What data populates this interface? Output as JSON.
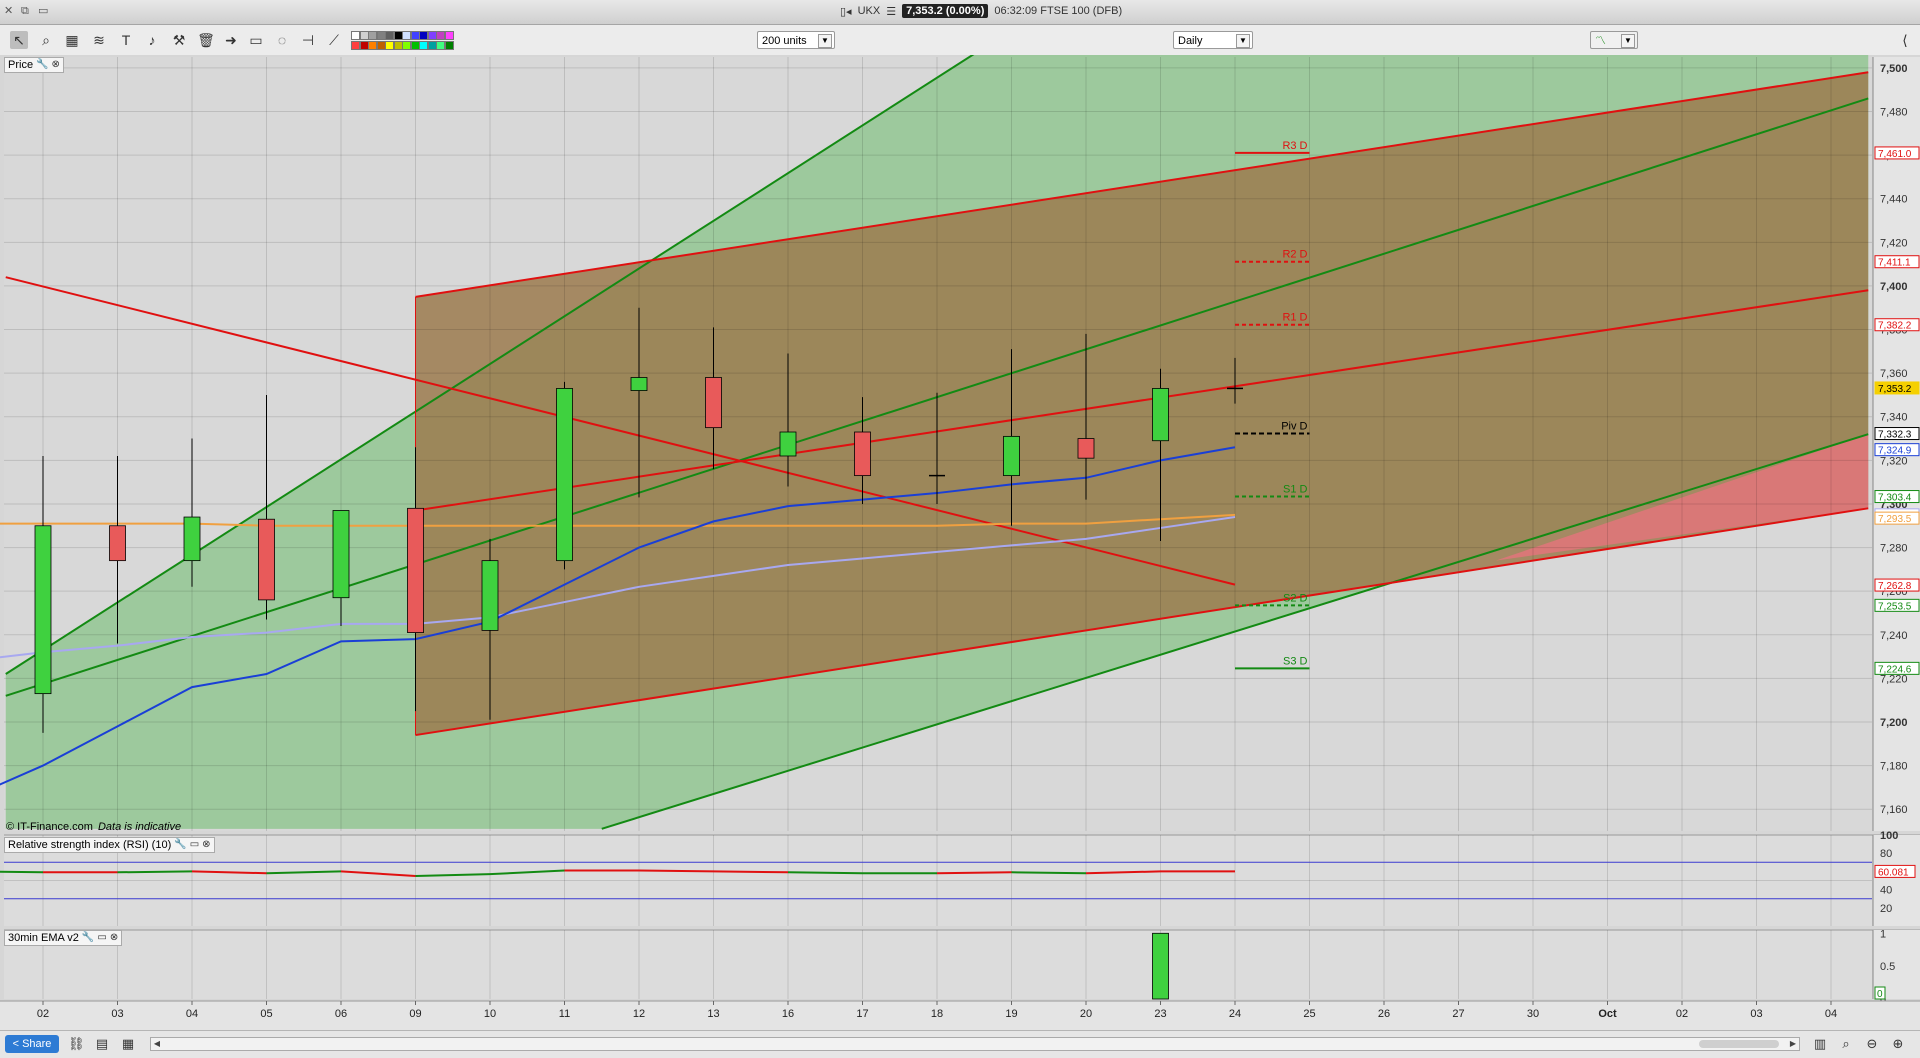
{
  "titlebar": {
    "symbol": "UKX",
    "price_box": "7,353.2 (0.00%)",
    "time_instrument": "06:32:09 FTSE 100 (DFB)"
  },
  "toolbar": {
    "units_select": "200 units",
    "period_select": "Daily"
  },
  "panels": {
    "price_label": "Price",
    "rsi_label": "Relative strength index (RSI) (10)",
    "ema_label": "30min EMA v2",
    "copyright": "© IT-Finance.com",
    "indicative": "Data is indicative"
  },
  "bottombar": {
    "share_label": "Share"
  },
  "colors": {
    "up_candle": "#3fd13f",
    "down_candle": "#e85a5a",
    "green_band": "#5cb85c",
    "brown_band": "#9c7b4f",
    "red_line": "#e01010",
    "green_line": "#138a13",
    "blue_ema": "#1a3fd6",
    "lavender_ema": "#a8a8f0",
    "orange_line": "#f0a040",
    "price_tag": "#f5d000"
  },
  "chart_data": {
    "type": "candlestick",
    "x_tick_labels": [
      "02",
      "03",
      "04",
      "05",
      "06",
      "09",
      "10",
      "11",
      "12",
      "13",
      "16",
      "17",
      "18",
      "19",
      "20",
      "23",
      "24",
      "25",
      "26",
      "27",
      "30",
      "Oct",
      "02",
      "03",
      "04"
    ],
    "ylim": [
      7150,
      7505
    ],
    "y_ticks": [
      7160,
      7180,
      7200,
      7220,
      7240,
      7260,
      7280,
      7300,
      7320,
      7340,
      7360,
      7380,
      7400,
      7420,
      7440,
      7460,
      7480,
      7500
    ],
    "y_tick_labels": [
      "7,160",
      "7,180",
      "7,200",
      "7,220",
      "7,240",
      "7,260",
      "7,280",
      "7,300",
      "7,320",
      "7,340",
      "7,360",
      "7,380",
      "7,400",
      "7,420",
      "7,440",
      "7,460",
      "7,480",
      "7,500"
    ],
    "bold_y_ticks": [
      7200,
      7300,
      7400,
      7500
    ],
    "candles": [
      {
        "x": "02",
        "open": 7213,
        "high": 7322,
        "low": 7195,
        "close": 7290
      },
      {
        "x": "03",
        "open": 7290,
        "high": 7322,
        "low": 7236,
        "close": 7274
      },
      {
        "x": "04",
        "open": 7274,
        "high": 7330,
        "low": 7262,
        "close": 7294
      },
      {
        "x": "05",
        "open": 7293,
        "high": 7350,
        "low": 7247,
        "close": 7256
      },
      {
        "x": "06",
        "open": 7257,
        "high": 7297,
        "low": 7244,
        "close": 7297
      },
      {
        "x": "09",
        "open": 7298,
        "high": 7326,
        "low": 7205,
        "close": 7241
      },
      {
        "x": "10",
        "open": 7242,
        "high": 7284,
        "low": 7201,
        "close": 7274
      },
      {
        "x": "11",
        "open": 7274,
        "high": 7356,
        "low": 7270,
        "close": 7353
      },
      {
        "x": "12",
        "open": 7352,
        "high": 7390,
        "low": 7303,
        "close": 7358
      },
      {
        "x": "13",
        "open": 7358,
        "high": 7381,
        "low": 7316,
        "close": 7335
      },
      {
        "x": "16",
        "open": 7322,
        "high": 7369,
        "low": 7308,
        "close": 7333
      },
      {
        "x": "17",
        "open": 7333,
        "high": 7349,
        "low": 7300,
        "close": 7313
      },
      {
        "x": "18",
        "open": 7313,
        "high": 7351,
        "low": 7300,
        "close": 7313
      },
      {
        "x": "19",
        "open": 7313,
        "high": 7371,
        "low": 7290,
        "close": 7331
      },
      {
        "x": "20",
        "open": 7330,
        "high": 7378,
        "low": 7302,
        "close": 7321
      },
      {
        "x": "23",
        "open": 7329,
        "high": 7362,
        "low": 7283,
        "close": 7353
      },
      {
        "x": "24",
        "open": 7353,
        "high": 7367,
        "low": 7346,
        "close": 7353
      }
    ],
    "ema_blue": [
      [
        0,
        7165
      ],
      [
        1,
        7180
      ],
      [
        2,
        7198
      ],
      [
        3,
        7216
      ],
      [
        4,
        7222
      ],
      [
        5,
        7237
      ],
      [
        6,
        7238
      ],
      [
        7,
        7246
      ],
      [
        8,
        7263
      ],
      [
        9,
        7280
      ],
      [
        10,
        7292
      ],
      [
        11,
        7299
      ],
      [
        12,
        7302
      ],
      [
        13,
        7305
      ],
      [
        14,
        7309
      ],
      [
        15,
        7312
      ],
      [
        16,
        7320
      ],
      [
        17,
        7326
      ]
    ],
    "ema_lavender": [
      [
        0,
        7228
      ],
      [
        1,
        7232
      ],
      [
        2,
        7235
      ],
      [
        3,
        7239
      ],
      [
        4,
        7241
      ],
      [
        5,
        7245
      ],
      [
        6,
        7245
      ],
      [
        7,
        7248
      ],
      [
        8,
        7255
      ],
      [
        9,
        7262
      ],
      [
        10,
        7267
      ],
      [
        11,
        7272
      ],
      [
        12,
        7275
      ],
      [
        13,
        7278
      ],
      [
        14,
        7281
      ],
      [
        15,
        7284
      ],
      [
        16,
        7289
      ],
      [
        17,
        7294
      ]
    ],
    "orange_line": [
      [
        0,
        7291
      ],
      [
        1,
        7291
      ],
      [
        2,
        7291
      ],
      [
        3,
        7291
      ],
      [
        4,
        7290
      ],
      [
        5,
        7290
      ],
      [
        6,
        7290
      ],
      [
        7,
        7290
      ],
      [
        8,
        7290
      ],
      [
        9,
        7290
      ],
      [
        10,
        7290
      ],
      [
        11,
        7290
      ],
      [
        12,
        7290
      ],
      [
        13,
        7290
      ],
      [
        14,
        7291
      ],
      [
        15,
        7291
      ],
      [
        16,
        7293
      ],
      [
        17,
        7295
      ]
    ],
    "pivots": [
      {
        "label": "R3 D",
        "value": 7461.0,
        "color": "#e01010",
        "style": "solid"
      },
      {
        "label": "R2 D",
        "value": 7411.1,
        "color": "#e01010",
        "style": "dashed"
      },
      {
        "label": "R1 D",
        "value": 7382.2,
        "color": "#e01010",
        "style": "dashed"
      },
      {
        "label": "Piv D",
        "value": 7332.3,
        "color": "#000000",
        "style": "dashed"
      },
      {
        "label": "S1 D",
        "value": 7303.4,
        "color": "#138a13",
        "style": "dashed"
      },
      {
        "label": "S2 D",
        "value": 7253.5,
        "color": "#138a13",
        "style": "dashed"
      },
      {
        "label": "S3 D",
        "value": 7224.6,
        "color": "#138a13",
        "style": "solid"
      }
    ],
    "price_tags": [
      {
        "text": "7,461.0",
        "value": 7461.0,
        "color": "#e01010"
      },
      {
        "text": "7,411.1",
        "value": 7411.1,
        "color": "#e01010"
      },
      {
        "text": "7,382.2",
        "value": 7382.2,
        "color": "#e01010"
      },
      {
        "text": "7,353.2",
        "value": 7353.2,
        "color": "#f5d000"
      },
      {
        "text": "7,332.3",
        "value": 7332.3,
        "color": "#000000"
      },
      {
        "text": "7,324.9",
        "value": 7324.9,
        "color": "#1a3fd6"
      },
      {
        "text": "7,303.4",
        "value": 7303.4,
        "color": "#138a13"
      },
      {
        "text": "7,295.0",
        "value": 7295.0,
        "color": "#a8a8f0"
      },
      {
        "text": "7,293.5",
        "value": 7293.5,
        "color": "#f0a040"
      },
      {
        "text": "7,262.8",
        "value": 7262.8,
        "color": "#e01010"
      },
      {
        "text": "7,253.5",
        "value": 7253.5,
        "color": "#138a13"
      },
      {
        "text": "7,224.6",
        "value": 7224.6,
        "color": "#138a13"
      }
    ],
    "trend_lines": {
      "green_upper": [
        [
          -0.5,
          7222
        ],
        [
          12.8,
          7513
        ]
      ],
      "green_mid": [
        [
          -0.5,
          7212
        ],
        [
          24.5,
          7486
        ]
      ],
      "green_lower": [
        [
          7.5,
          7151
        ],
        [
          24.5,
          7332
        ]
      ],
      "red_upper": [
        [
          5,
          7395
        ],
        [
          24.5,
          7498
        ]
      ],
      "red_mid": [
        [
          5,
          7297
        ],
        [
          24.5,
          7398
        ]
      ],
      "red_lower": [
        [
          5,
          7194
        ],
        [
          24.5,
          7298
        ]
      ],
      "red_down": [
        [
          -0.5,
          7404
        ],
        [
          16,
          7263
        ]
      ],
      "brown_band": [
        [
          5,
          7395
        ],
        [
          24.5,
          7498
        ],
        [
          24.5,
          7298
        ],
        [
          5,
          7194
        ]
      ],
      "green_channel": [
        [
          -0.5,
          7222
        ],
        [
          12.8,
          7513
        ],
        [
          24.5,
          7513
        ],
        [
          24.5,
          7332
        ],
        [
          7.5,
          7151
        ],
        [
          -0.5,
          7151
        ]
      ],
      "pink_wedge": [
        [
          19.5,
          7274
        ],
        [
          24.5,
          7332
        ],
        [
          24.5,
          7298
        ]
      ]
    },
    "rsi": {
      "ylim": [
        0,
        100
      ],
      "ticks": [
        100,
        80,
        60,
        40,
        20
      ],
      "upper_band": 70,
      "lower_band": 30,
      "last_value_label": "60.081",
      "values": [
        [
          0,
          60
        ],
        [
          1,
          59
        ],
        [
          2,
          59
        ],
        [
          3,
          60
        ],
        [
          4,
          58
        ],
        [
          5,
          60
        ],
        [
          6,
          55
        ],
        [
          7,
          57
        ],
        [
          8,
          61
        ],
        [
          9,
          61
        ],
        [
          10,
          60
        ],
        [
          11,
          59
        ],
        [
          12,
          58
        ],
        [
          13,
          58
        ],
        [
          14,
          59
        ],
        [
          15,
          58
        ],
        [
          16,
          60
        ],
        [
          17,
          60
        ]
      ],
      "segment_colors": [
        "#138a13",
        "#e01010",
        "#138a13",
        "#e01010",
        "#138a13",
        "#e01010",
        "#138a13",
        "#138a13",
        "#e01010",
        "#e01010",
        "#e01010",
        "#138a13",
        "#138a13",
        "#e01010",
        "#138a13",
        "#e01010",
        "#e01010"
      ]
    },
    "ema30": {
      "ylim": [
        0,
        1.05
      ],
      "ticks": [
        "1",
        "0.5",
        "0"
      ],
      "bars": [
        {
          "x": "23",
          "value": 1
        }
      ],
      "last_value_label": "0"
    }
  }
}
